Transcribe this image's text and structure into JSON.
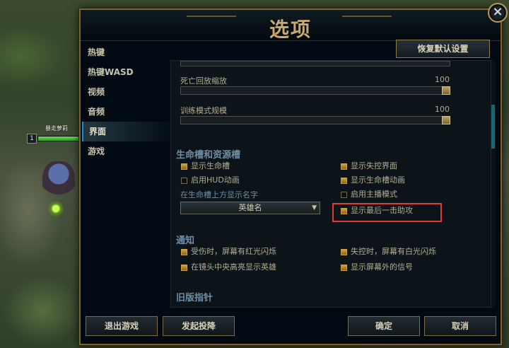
{
  "game": {
    "hero_name": "暴走萝莉",
    "hero_level": "1",
    "hero_hp_fraction": 0.98
  },
  "dialog": {
    "title": "选项",
    "close_icon": "close-icon"
  },
  "nav": {
    "items": [
      {
        "label": "热键",
        "active": false
      },
      {
        "label": "热键WASD",
        "active": false
      },
      {
        "label": "视频",
        "active": false
      },
      {
        "label": "音频",
        "active": false
      },
      {
        "label": "界面",
        "active": true
      },
      {
        "label": "游戏",
        "active": false
      }
    ]
  },
  "reset_label": "恢复默认设置",
  "sliders": [
    {
      "label": "死亡回放缩放",
      "value": "100"
    },
    {
      "label": "训练模式规模",
      "value": "100"
    }
  ],
  "health_section": {
    "title": "生命槽和资源槽",
    "options_left": [
      {
        "label": "显示生命槽",
        "checked": true
      },
      {
        "label": "启用HUD动画",
        "checked": false
      }
    ],
    "options_right": [
      {
        "label": "显示失控界面",
        "checked": true
      },
      {
        "label": "显示生命槽动画",
        "checked": true
      },
      {
        "label": "启用主播模式",
        "checked": false
      },
      {
        "label": "显示最后一击助攻",
        "checked": true
      }
    ],
    "name_label": "在生命槽上方显示名字",
    "name_dropdown": "英雄名"
  },
  "notify_section": {
    "title": "通知",
    "options_left": [
      {
        "label": "受伤时，屏幕有红光闪烁",
        "checked": true
      },
      {
        "label": "在镜头中央高亮显示英雄",
        "checked": true
      }
    ],
    "options_right": [
      {
        "label": "失控时，屏幕有白光闪烁",
        "checked": true
      },
      {
        "label": "显示屏幕外的信号",
        "checked": true
      }
    ]
  },
  "legacy_section": {
    "title": "旧版指针"
  },
  "footer": {
    "exit": "退出游戏",
    "surrender": "发起投降",
    "confirm": "确定",
    "cancel": "取消"
  },
  "colors": {
    "gold_frame": "#7a6431",
    "title_gold": "#c8aa6e",
    "section_blue": "#6e8ea6",
    "highlight_red": "#e23a3a",
    "checkbox_gold": "#c7a248"
  }
}
